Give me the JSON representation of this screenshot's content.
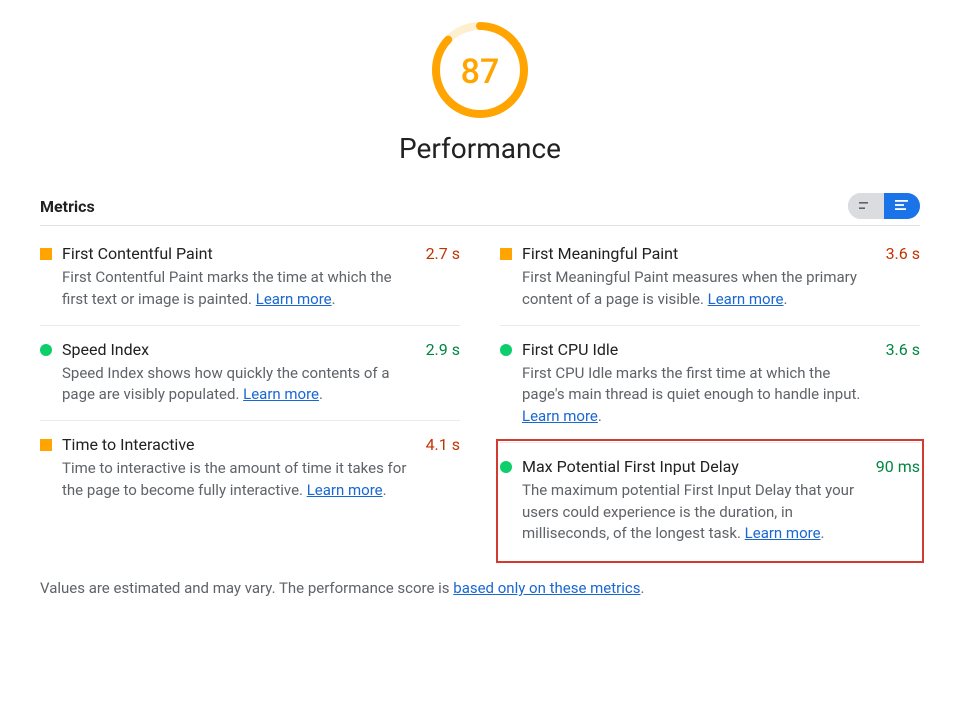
{
  "score": {
    "value": 87,
    "max": 100
  },
  "category_title": "Performance",
  "metrics_heading": "Metrics",
  "columns": [
    [
      {
        "status": "average",
        "title": "First Contentful Paint",
        "value": "2.7 s",
        "desc_before": "First Contentful Paint marks the time at which the first text or image is painted. ",
        "link": "Learn more",
        "desc_after": "."
      },
      {
        "status": "fast",
        "title": "Speed Index",
        "value": "2.9 s",
        "desc_before": "Speed Index shows how quickly the contents of a page are visibly populated. ",
        "link": "Learn more",
        "desc_after": "."
      },
      {
        "status": "average",
        "title": "Time to Interactive",
        "value": "4.1 s",
        "desc_before": "Time to interactive is the amount of time it takes for the page to become fully interactive. ",
        "link": "Learn more",
        "desc_after": "."
      }
    ],
    [
      {
        "status": "average",
        "title": "First Meaningful Paint",
        "value": "3.6 s",
        "desc_before": "First Meaningful Paint measures when the primary content of a page is visible. ",
        "link": "Learn more",
        "desc_after": "."
      },
      {
        "status": "fast",
        "title": "First CPU Idle",
        "value": "3.6 s",
        "desc_before": "First CPU Idle marks the first time at which the page's main thread is quiet enough to handle input. ",
        "link": "Learn more",
        "desc_after": "."
      },
      {
        "status": "fast",
        "title": "Max Potential First Input Delay",
        "value": "90 ms",
        "highlight": true,
        "desc_before": "The maximum potential First Input Delay that your users could experience is the duration, in milliseconds, of the longest task. ",
        "link": "Learn more",
        "desc_after": "."
      }
    ]
  ],
  "footnote": {
    "before": "Values are estimated and may vary. The performance score is ",
    "link": "based only on these metrics",
    "after": "."
  }
}
